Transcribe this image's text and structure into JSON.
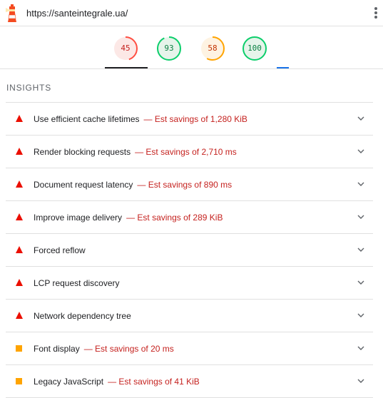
{
  "header": {
    "url": "https://santeintegrale.ua/",
    "logo_icon": "lighthouse-icon",
    "menu_icon": "kebab-menu-icon"
  },
  "scores": [
    {
      "value": "45",
      "fraction": 0.45,
      "color": "#ff4e42",
      "bg": "#fce8e6"
    },
    {
      "value": "93",
      "fraction": 0.93,
      "color": "#0cce6b",
      "bg": "#e6f4ea"
    },
    {
      "value": "58",
      "fraction": 0.58,
      "color": "#ffa400",
      "bg": "#fef3e2"
    },
    {
      "value": "100",
      "fraction": 1.0,
      "color": "#0cce6b",
      "bg": "#e6f4ea"
    }
  ],
  "insights": {
    "title": "INSIGHTS",
    "items": [
      {
        "label": "Use efficient cache lifetimes",
        "savings": "— Est savings of 1,280 KiB",
        "severity": "fail"
      },
      {
        "label": "Render blocking requests",
        "savings": "— Est savings of 2,710 ms",
        "severity": "fail"
      },
      {
        "label": "Document request latency",
        "savings": "— Est savings of 890 ms",
        "severity": "fail"
      },
      {
        "label": "Improve image delivery",
        "savings": "— Est savings of 289 KiB",
        "severity": "fail"
      },
      {
        "label": "Forced reflow",
        "savings": "",
        "severity": "fail"
      },
      {
        "label": "LCP request discovery",
        "savings": "",
        "severity": "fail"
      },
      {
        "label": "Network dependency tree",
        "savings": "",
        "severity": "fail"
      },
      {
        "label": "Font display",
        "savings": "— Est savings of 20 ms",
        "severity": "average"
      },
      {
        "label": "Legacy JavaScript",
        "savings": "— Est savings of 41 KiB",
        "severity": "average"
      }
    ]
  },
  "colors": {
    "fail": "#eb0f00",
    "average": "#ffa400",
    "savings": "#c5221f"
  }
}
